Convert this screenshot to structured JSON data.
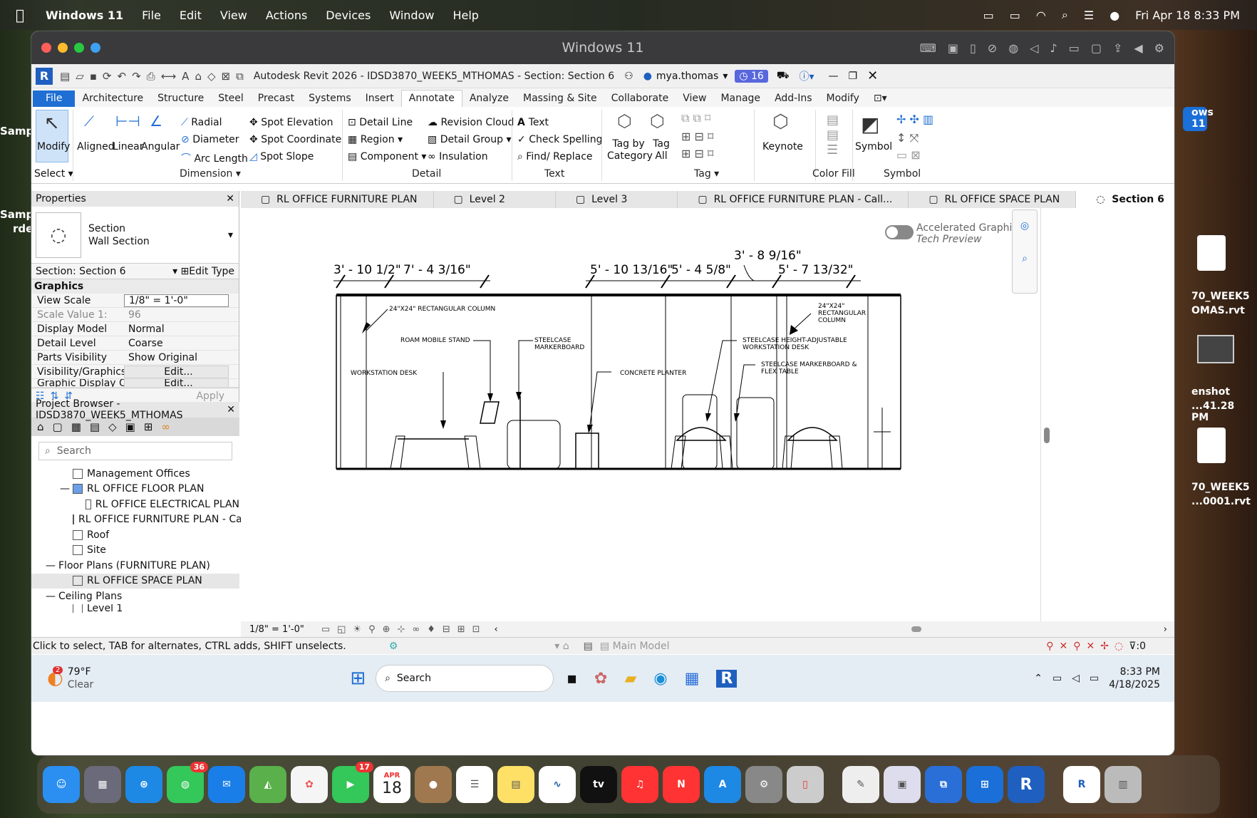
{
  "mac": {
    "apple": "",
    "app": "Windows 11",
    "menus": [
      "File",
      "Edit",
      "View",
      "Actions",
      "Devices",
      "Window",
      "Help"
    ],
    "datetime": "Fri Apr 18  8:33 PM"
  },
  "window": {
    "title": "Windows 11"
  },
  "qat": {
    "app_title": "Autodesk Revit 2026 - IDSD3870_WEEK5_MTHOMAS - Section: Section 6",
    "user": "mya.thomas",
    "badge": "16"
  },
  "ribbon_tabs": [
    "File",
    "Architecture",
    "Structure",
    "Steel",
    "Precast",
    "Systems",
    "Insert",
    "Annotate",
    "Analyze",
    "Massing & Site",
    "Collaborate",
    "View",
    "Manage",
    "Add-Ins",
    "Modify"
  ],
  "ribbon": {
    "modify": "Modify",
    "select": "Select",
    "aligned": "Aligned",
    "linear": "Linear",
    "angular": "Angular",
    "radial": "Radial",
    "diameter": "Diameter",
    "arc_length": "Arc  Length",
    "spot_elev": "Spot  Elevation",
    "spot_coord": "Spot  Coordinate",
    "spot_slope": "Spot  Slope",
    "dimension": "Dimension",
    "detail_line": "Detail  Line",
    "region": "Region",
    "component": "Component",
    "revision_cloud": "Revision  Cloud",
    "detail_group": "Detail  Group",
    "insulation": "Insulation",
    "detail": "Detail",
    "text": "Text",
    "check_spelling": "Check  Spelling",
    "find_replace": "Find/  Replace",
    "text_grp": "Text",
    "tag_by_cat": "Tag by Category",
    "tag_all": "Tag All",
    "tag": "Tag",
    "keynote": "Keynote",
    "color_fill": "Color Fill",
    "symbol": "Symbol",
    "symbol_grp": "Symbol"
  },
  "properties": {
    "title": "Properties",
    "type1": "Section",
    "type2": "Wall Section",
    "selector": "Section: Section 6",
    "edit_type": "Edit Type",
    "group": "Graphics",
    "rows": [
      {
        "k": "View Scale",
        "v": "1/8\" = 1'-0\""
      },
      {
        "k": "Scale Value    1:",
        "v": "96"
      },
      {
        "k": "Display Model",
        "v": "Normal"
      },
      {
        "k": "Detail Level",
        "v": "Coarse"
      },
      {
        "k": "Parts Visibility",
        "v": "Show Original"
      },
      {
        "k": "Visibility/Graphics ...",
        "v": "Edit..."
      },
      {
        "k": "Graphic Display Op...",
        "v": "Edit..."
      }
    ],
    "apply": "Apply"
  },
  "browser": {
    "title": "Project Browser - IDSD3870_WEEK5_MTHOMAS",
    "search": "Search",
    "items": [
      "Management Offices",
      "RL OFFICE FLOOR PLAN",
      "RL OFFICE ELECTRICAL PLAN",
      "RL OFFICE FURNITURE PLAN - Cal",
      "Roof",
      "Site",
      "Floor Plans (FURNITURE PLAN)",
      "RL OFFICE SPACE PLAN",
      "Ceiling Plans",
      "Level 1"
    ]
  },
  "view_tabs": [
    "RL OFFICE FURNITURE PLAN",
    "Level 2",
    "Level 3",
    "RL OFFICE FURNITURE PLAN - Call...",
    "RL OFFICE SPACE PLAN",
    "Section 6"
  ],
  "canvas": {
    "accel1": "Accelerated Graphics",
    "accel2": "Tech Preview",
    "dims": [
      "3' - 10 1/2\"",
      "7' - 4 3/16\"",
      "5' - 10 13/16\"",
      "5' - 4 5/8\"",
      "3' - 8 9/16\"",
      "5' - 7 13/32\""
    ],
    "labels": [
      "24\"X24\" RECTANGULAR COLUMN",
      "ROAM MOBILE STAND",
      "STEELCASE",
      "MARKERBOARD",
      "WORKSTATION DESK",
      "CONCRETE PLANTER",
      "STEELCASE HEIGHT-ADJUSTABLE",
      "WORKSTATION DESK",
      "STEELCASE MARKERBOARD &",
      "FLEX TABLE",
      "24\"X24\"",
      "RECTANGULAR",
      "COLUMN"
    ]
  },
  "viewbar": {
    "scale": "1/8\" = 1'-0\""
  },
  "status": {
    "text": "Click to select, TAB for alternates, CTRL adds, SHIFT unselects.",
    "model": "Main Model",
    "filter": ":0"
  },
  "taskbar": {
    "temp": "79°F",
    "cond": "Clear",
    "search": "Search",
    "time": "8:33 PM",
    "date": "4/18/2025",
    "weather_badge": "2"
  },
  "desktop": {
    "left1": "Sampl",
    "left2": "Sampl",
    "left3": "rder",
    "right1": "ows 11",
    "right2": "70_WEEK5",
    "right3": "OMAS.rvt",
    "right4": "enshot",
    "right5": "...41.28 PM",
    "right6": "70_WEEK5",
    "right7": "...0001.rvt"
  },
  "dock": {
    "messages_badge": "36",
    "facetime_badge": "17",
    "cal_month": "APR",
    "cal_day": "18",
    "tv": "tv"
  }
}
